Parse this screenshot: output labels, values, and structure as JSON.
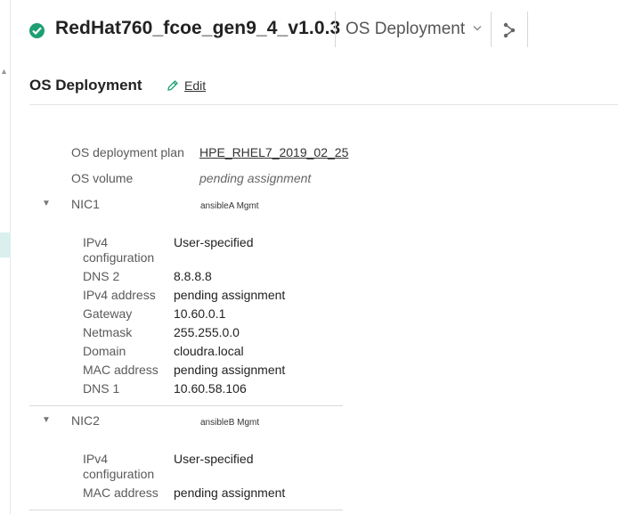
{
  "header": {
    "title": "RedHat760_fcoe_gen9_4_v1.0.3",
    "status": "ok",
    "view_selector": "OS Deployment",
    "status_color": "#1e9e74"
  },
  "section": {
    "title": "OS Deployment",
    "edit_label": "Edit"
  },
  "os": {
    "plan_label": "OS deployment plan",
    "plan_value": "HPE_RHEL7_2019_02_25",
    "volume_label": "OS volume",
    "volume_value": "pending assignment"
  },
  "nics": [
    {
      "name": "NIC1",
      "network": "ansibleA Mgmt",
      "fields": [
        {
          "label": "IPv4 configuration",
          "value": "User-specified"
        },
        {
          "label": "DNS 2",
          "value": "8.8.8.8"
        },
        {
          "label": "IPv4 address",
          "value": "pending assignment"
        },
        {
          "label": "Gateway",
          "value": "10.60.0.1"
        },
        {
          "label": "Netmask",
          "value": "255.255.0.0"
        },
        {
          "label": "Domain",
          "value": "cloudra.local"
        },
        {
          "label": "MAC address",
          "value": "pending assignment"
        },
        {
          "label": "DNS 1",
          "value": "10.60.58.106"
        }
      ]
    },
    {
      "name": "NIC2",
      "network": "ansibleB Mgmt",
      "fields": [
        {
          "label": "IPv4 configuration",
          "value": "User-specified"
        },
        {
          "label": "MAC address",
          "value": "pending assignment"
        }
      ]
    }
  ]
}
